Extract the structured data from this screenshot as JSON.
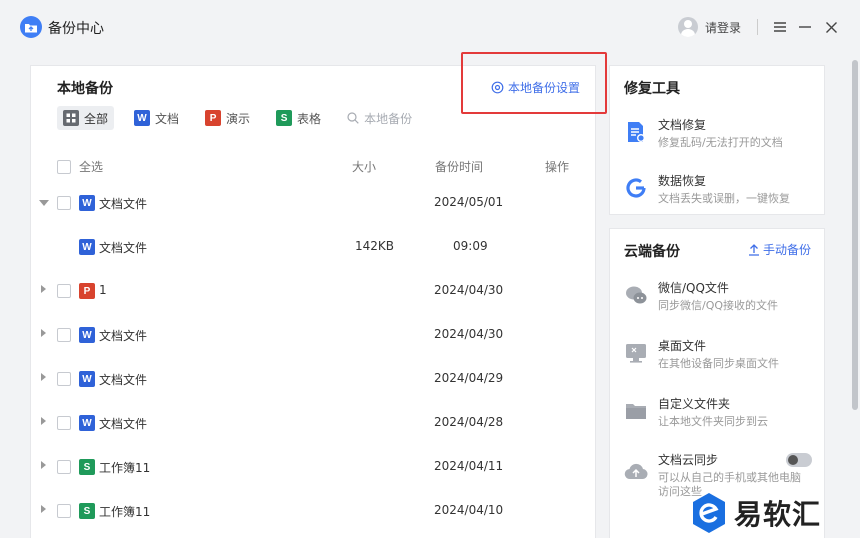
{
  "app": {
    "title": "备份中心",
    "login_label": "请登录"
  },
  "local_backup": {
    "title": "本地备份",
    "settings_label": "本地备份设置",
    "filters": [
      {
        "badge": "",
        "label": "全部"
      },
      {
        "badge": "W",
        "label": "文档"
      },
      {
        "badge": "P",
        "label": "演示"
      },
      {
        "badge": "S",
        "label": "表格"
      },
      {
        "badge": "",
        "label": "本地备份"
      }
    ],
    "columns": {
      "select_all": "全选",
      "size": "大小",
      "time": "备份时间",
      "action": "操作"
    },
    "rows": [
      {
        "type": "W",
        "name": "文档文件",
        "size": "",
        "time": "2024/05/01"
      },
      {
        "type": "W",
        "name": "文档文件",
        "size": "142KB",
        "time": "09:09"
      },
      {
        "type": "P",
        "name": "1",
        "size": "",
        "time": "2024/04/30"
      },
      {
        "type": "W",
        "name": "文档文件",
        "size": "",
        "time": "2024/04/30"
      },
      {
        "type": "W",
        "name": "文档文件",
        "size": "",
        "time": "2024/04/29"
      },
      {
        "type": "W",
        "name": "文档文件",
        "size": "",
        "time": "2024/04/28"
      },
      {
        "type": "S",
        "name": "工作簿11",
        "size": "",
        "time": "2024/04/11"
      },
      {
        "type": "S",
        "name": "工作簿11",
        "size": "",
        "time": "2024/04/10"
      }
    ]
  },
  "repair_tools": {
    "title": "修复工具",
    "items": [
      {
        "name": "文档修复",
        "desc": "修复乱码/无法打开的文档"
      },
      {
        "name": "数据恢复",
        "desc": "文档丢失或误删，一键恢复"
      }
    ]
  },
  "cloud_backup": {
    "title": "云端备份",
    "manual_label": "手动备份",
    "items": [
      {
        "name": "微信/QQ文件",
        "desc": "同步微信/QQ接收的文件"
      },
      {
        "name": "桌面文件",
        "desc": "在其他设备同步桌面文件"
      },
      {
        "name": "自定义文件夹",
        "desc": "让本地文件夹同步到云"
      },
      {
        "name": "文档云同步",
        "desc": "可以从自己的手机或其他电脑",
        "desc2": "访问这些"
      }
    ]
  },
  "watermark": {
    "text": "易软汇"
  },
  "colors": {
    "accent": "#3f6ee8",
    "highlight": "#e33a3a",
    "word": "#2f62d8",
    "ppt": "#d8432e",
    "sheet": "#1f9a5a"
  }
}
